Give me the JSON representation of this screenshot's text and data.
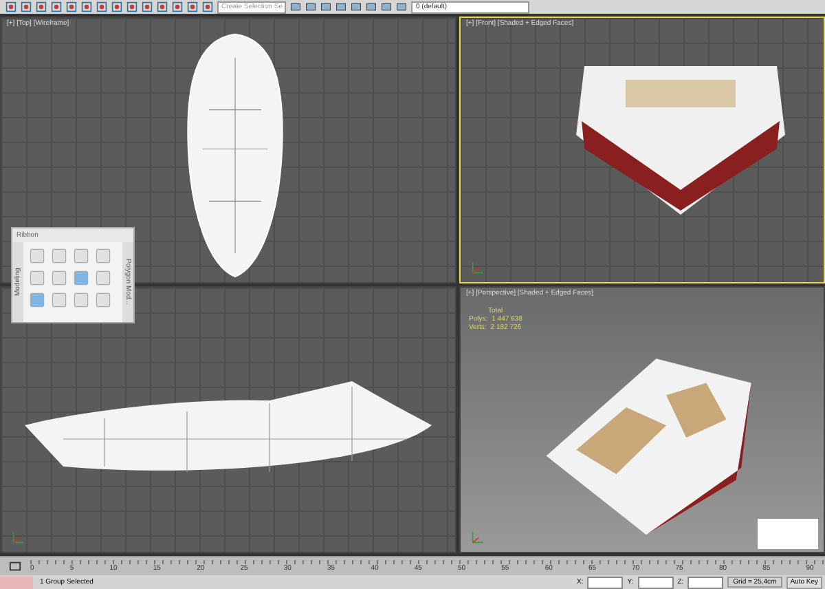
{
  "toolbar": {
    "selection_set_placeholder": "Create Selection Se",
    "layer": "0 (default)"
  },
  "viewports": [
    {
      "kind": "top",
      "label": "[+] [Top] [Wireframe]",
      "selected": false
    },
    {
      "kind": "front",
      "label": "[+] [Front] [Shaded + Edged Faces]",
      "selected": true
    },
    {
      "kind": "left",
      "selected": false
    },
    {
      "kind": "perspective",
      "label": "[+] [Perspective] [Shaded + Edged Faces]",
      "selected": false
    }
  ],
  "statistics": {
    "title": "Total",
    "rows": [
      {
        "label": "Polys:",
        "value": "1 447 638"
      },
      {
        "label": "Verts:",
        "value": "2 182 726"
      }
    ]
  },
  "ribbon": {
    "title": "Ribbon",
    "side_tabs": [
      "Modeling",
      "Polygon Mod..."
    ]
  },
  "timeline": {
    "ticks": [
      "0",
      "5",
      "10",
      "15",
      "20",
      "25",
      "30",
      "35",
      "40",
      "45",
      "50",
      "55",
      "60",
      "65",
      "70",
      "75",
      "80",
      "85",
      "90"
    ]
  },
  "status_bar": {
    "message": "1 Group Selected",
    "coords": [
      "X:",
      "Y:",
      "Z:"
    ],
    "grid": "Grid = 25,4cm",
    "auto_key": "Auto Key"
  }
}
